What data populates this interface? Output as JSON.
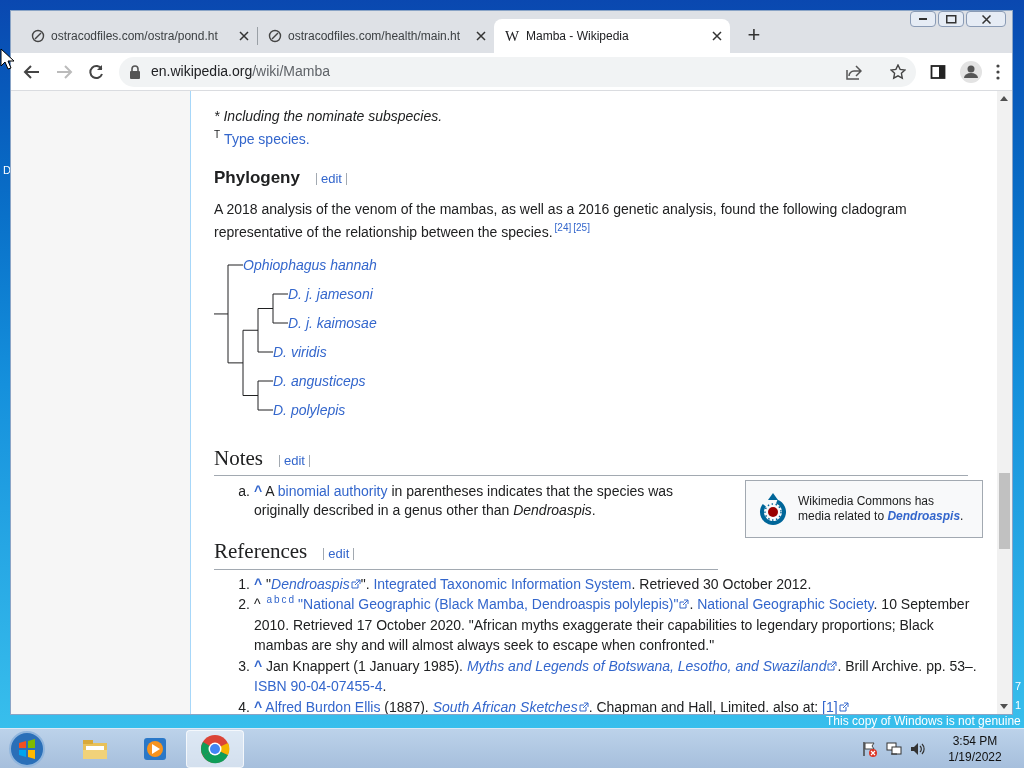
{
  "desktop": {
    "fragments": [
      "D",
      "7",
      "1"
    ],
    "genuine_notice": "This copy of Windows is not genuine"
  },
  "browser": {
    "tabs": [
      {
        "title": "ostracodfiles.com/ostra/pond.ht",
        "selected": false
      },
      {
        "title": "ostracodfiles.com/health/main.ht",
        "selected": false
      },
      {
        "title": "Mamba - Wikipedia",
        "favicon_text": "W",
        "selected": true
      }
    ],
    "new_tab": "+",
    "forward_disabled": true,
    "url_host": "en.wikipedia.org",
    "url_path": "/wiki/Mamba"
  },
  "article": {
    "footnotes": [
      {
        "mark": "*",
        "segments": [
          {
            "kind": "italic",
            "text": "Including the nominate subspecies."
          }
        ]
      },
      {
        "mark": "T",
        "segments": [
          {
            "kind": "link",
            "text": "Type species."
          }
        ]
      }
    ],
    "phylogeny": {
      "heading": "Phylogeny",
      "edit": "edit",
      "paragraph": [
        {
          "kind": "text",
          "text": "A 2018 analysis of the venom of the mambas, as well as a 2016 genetic analysis, found the following cladogram representative of the relationship between the species."
        },
        {
          "kind": "sup_link",
          "text": "[24]"
        },
        {
          "kind": "sup_link",
          "text": "[25]"
        }
      ],
      "cladogram": {
        "children": [
          {
            "label": "Ophiophagus hannah"
          },
          {
            "children": [
              {
                "children": [
                  {
                    "children": [
                      {
                        "label": "D. j. jamesoni"
                      },
                      {
                        "label": "D. j. kaimosae"
                      }
                    ]
                  },
                  {
                    "label": "D. viridis"
                  }
                ]
              },
              {
                "children": [
                  {
                    "label": "D. angusticeps"
                  },
                  {
                    "label": "D. polylepis"
                  }
                ]
              }
            ]
          }
        ]
      }
    },
    "notes": {
      "heading": "Notes",
      "edit": "edit",
      "items": [
        {
          "marker": "a.",
          "segments": [
            {
              "kind": "backlink",
              "text": "^"
            },
            {
              "kind": "text",
              "text": " A "
            },
            {
              "kind": "link",
              "text": "binomial authority"
            },
            {
              "kind": "text",
              "text": " in parentheses indicates that the species was originally described in a genus other than "
            },
            {
              "kind": "italic",
              "text": "Dendroaspis"
            },
            {
              "kind": "text",
              "text": "."
            }
          ]
        }
      ],
      "commons": [
        {
          "kind": "text",
          "text": "Wikimedia Commons has media related to "
        },
        {
          "kind": "bold_italic_link",
          "text": "Dendroaspis"
        },
        {
          "kind": "text",
          "text": "."
        }
      ]
    },
    "references": {
      "heading": "References",
      "edit": "edit",
      "items": [
        {
          "marker": "1.",
          "segments": [
            {
              "kind": "backlink",
              "text": "^"
            },
            {
              "kind": "text",
              "text": " \""
            },
            {
              "kind": "italic_ext_link",
              "text": "Dendroaspis"
            },
            {
              "kind": "text",
              "text": "\". "
            },
            {
              "kind": "link",
              "text": "Integrated Taxonomic Information System"
            },
            {
              "kind": "text",
              "text": ". Retrieved 30 October 2012."
            }
          ]
        },
        {
          "marker": "2.",
          "segments": [
            {
              "kind": "text",
              "text": "^ "
            },
            {
              "kind": "sup_link",
              "text": "a"
            },
            {
              "kind": "sup_link",
              "text": "b"
            },
            {
              "kind": "sup_link",
              "text": "c"
            },
            {
              "kind": "sup_link",
              "text": "d"
            },
            {
              "kind": "space"
            },
            {
              "kind": "ext_link",
              "text": "\"National Geographic (Black Mamba, Dendroaspis polylepis)\""
            },
            {
              "kind": "text",
              "text": ". "
            },
            {
              "kind": "link",
              "text": "National Geographic Society"
            },
            {
              "kind": "text",
              "text": ". 10 September 2010. Retrieved 17 October 2020. \"African myths exaggerate their capabilities to legendary proportions; Black mambas are shy and will almost always seek to escape when confronted.\""
            }
          ]
        },
        {
          "marker": "3.",
          "segments": [
            {
              "kind": "backlink",
              "text": "^"
            },
            {
              "kind": "text",
              "text": " Jan Knappert (1 January 1985). "
            },
            {
              "kind": "italic_ext_link",
              "text": "Myths and Legends of Botswana, Lesotho, and Swaziland"
            },
            {
              "kind": "text",
              "text": ". Brill Archive. pp. 53–. "
            },
            {
              "kind": "link",
              "text": "ISBN 90-04-07455-4"
            },
            {
              "kind": "text",
              "text": "."
            }
          ]
        },
        {
          "marker": "4.",
          "segments": [
            {
              "kind": "backlink",
              "text": "^"
            },
            {
              "kind": "space"
            },
            {
              "kind": "link",
              "text": "Alfred Burdon Ellis"
            },
            {
              "kind": "text",
              "text": " (1887). "
            },
            {
              "kind": "italic_ext_link",
              "text": "South African Sketches"
            },
            {
              "kind": "text",
              "text": ". Chapman and Hall, Limited. also at: "
            },
            {
              "kind": "ext_link",
              "text": "[1]"
            }
          ]
        }
      ]
    }
  },
  "taskbar": {
    "apps": [
      {
        "kind": "explorer",
        "active": false
      },
      {
        "kind": "media",
        "active": false
      },
      {
        "kind": "chrome",
        "active": true
      }
    ],
    "time": "3:54 PM",
    "date": "1/19/2022"
  }
}
